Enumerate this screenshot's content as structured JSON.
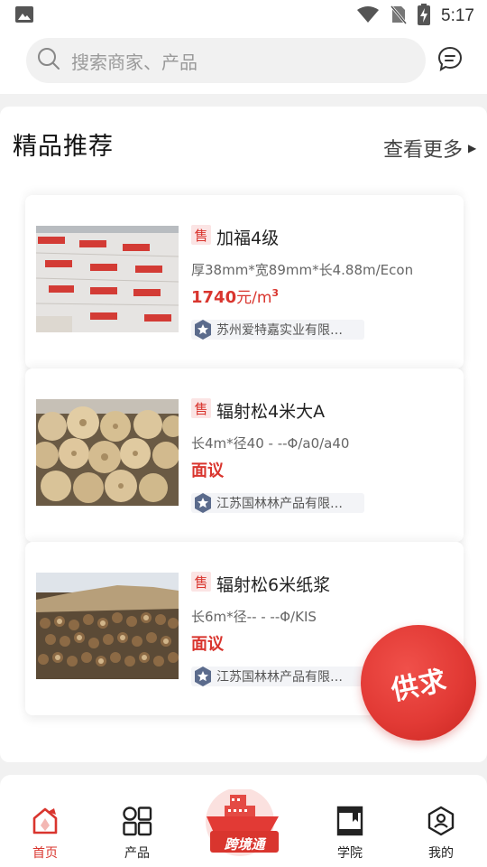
{
  "status_bar": {
    "time": "5:17"
  },
  "search": {
    "placeholder": "搜索商家、产品"
  },
  "section": {
    "title": "精品推荐",
    "more_label": "查看更多"
  },
  "products": [
    {
      "badge": "售",
      "name": "加福4级",
      "spec": "厚38mm*宽89mm*长4.88m/Econ",
      "price": "1740",
      "price_unit": "元/m",
      "price_sup": "3",
      "company": "苏州爱特嘉实业有限…"
    },
    {
      "badge": "售",
      "name": "辐射松4米大A",
      "spec": "长4m*径40 - --Φ/a0/a40",
      "price": "面议",
      "price_unit": "",
      "price_sup": "",
      "company": "江苏国林林产品有限…"
    },
    {
      "badge": "售",
      "name": "辐射松6米纸浆",
      "spec": "长6m*径-- - --Φ/KIS",
      "price": "面议",
      "price_unit": "",
      "price_sup": "",
      "company": "江苏国林林产品有限…"
    }
  ],
  "fab": {
    "label": "供求"
  },
  "nav": {
    "items": [
      {
        "label": "首页",
        "icon": "home-icon"
      },
      {
        "label": "产品",
        "icon": "grid-icon"
      },
      {
        "label": "跨境通",
        "icon": "ship-icon"
      },
      {
        "label": "学院",
        "icon": "book-icon"
      },
      {
        "label": "我的",
        "icon": "profile-icon"
      }
    ]
  },
  "colors": {
    "accent": "#d9352e",
    "background": "#f1f1f1"
  }
}
